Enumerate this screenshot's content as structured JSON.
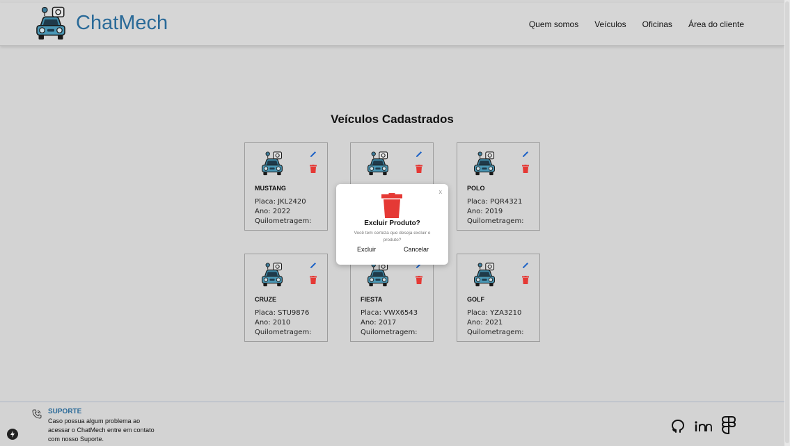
{
  "header": {
    "brand": "ChatMech",
    "nav": [
      "Quem somos",
      "Veículos",
      "Oficinas",
      "Área do cliente"
    ]
  },
  "page_title": "Veículos Cadastrados",
  "vehicles": [
    {
      "model": "MUSTANG",
      "placa": "Placa: JKL2420",
      "ano": "Ano: 2022",
      "km": "Quilometragem:"
    },
    {
      "model": "",
      "placa": "",
      "ano": "",
      "km": ""
    },
    {
      "model": "POLO",
      "placa": "Placa: PQR4321",
      "ano": "Ano: 2019",
      "km": "Quilometragem:"
    },
    {
      "model": "CRUZE",
      "placa": "Placa: STU9876",
      "ano": "Ano: 2010",
      "km": "Quilometragem:"
    },
    {
      "model": "FIESTA",
      "placa": "Placa: VWX6543",
      "ano": "Ano: 2017",
      "km": "Quilometragem:"
    },
    {
      "model": "GOLF",
      "placa": "Placa: YZA3210",
      "ano": "Ano: 2021",
      "km": "Quilometragem:"
    }
  ],
  "modal": {
    "close": "x",
    "title": "Excluir Produto?",
    "text": "Você tem certeza que deseja excluir o produto?",
    "confirm": "Excluir",
    "cancel": "Cancelar"
  },
  "footer": {
    "support_title": "SUPORTE",
    "support_text": "Caso possua algum problema ao acessar o ChatMech entre em contato com nosso Suporte.",
    "social": [
      "github-icon",
      "linkedin-icon",
      "figma-icon"
    ]
  },
  "colors": {
    "brand": "#2a6a98",
    "delete": "#e53935",
    "edit": "#1e63c6",
    "background": "#d3d3d3"
  }
}
